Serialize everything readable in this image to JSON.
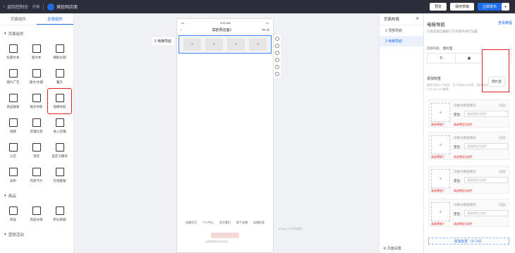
{
  "topbar": {
    "back_label": "返回控制台",
    "store_label": "店铺",
    "brand_label": "Bai",
    "page_name": "莫欧网店面",
    "preview": "预览",
    "save_draft": "保存草稿",
    "publish": "立即发布",
    "more_icon": "caret-down-icon"
  },
  "left": {
    "tabs": [
      "页面组件",
      "全局组件"
    ],
    "sections": [
      {
        "title": "页面组件",
        "items": [
          "标题文本",
          "富文本",
          "辅助分割",
          "图片广告",
          "图文/文图",
          "魔方",
          "商品搜索",
          "图文导航",
          "电梯导航",
          "视频",
          "店铺信息",
          "进入店铺",
          "公告",
          "语音",
          "自定义模块",
          "返积",
          "内容卡片",
          "在线客服"
        ]
      },
      {
        "title": "商品",
        "items": [
          "商品",
          "商品分组",
          "积分商城"
        ]
      },
      {
        "title": "营销活动",
        "items": []
      }
    ],
    "selected_item": "电梯导航"
  },
  "canvas": {
    "label": "2 电梯导航",
    "status_time": "9:41 AM",
    "page_title": "莫欧网店面1",
    "footer_links": [
      "店铺主页",
      "个人中心",
      "关注我们",
      "联下店铺",
      "店铺信息"
    ],
    "footer_note": "由有赞提供技术支持",
    "hint": "iPhone 13手机预览"
  },
  "layers": {
    "title": "页面布局",
    "items": [
      "1 顶部导航",
      "2 电梯导航"
    ],
    "active": "2 电梯导航",
    "footer": "页面设置"
  },
  "props": {
    "title": "电梯导航",
    "help": "查看教程",
    "desc": "只能选择已编辑下方的组件进行设置",
    "style_label": "选择导航",
    "style_value": "图片型",
    "style_options": [
      "Tr",
      "图",
      "图"
    ],
    "popup_label": "图片型",
    "add_label": "添加标签",
    "add_desc": "最多添加20个标签，至少添加4个标签，图片建议尺寸100*100像素",
    "cards": [
      {
        "name": "切换为橱窗模块",
        "loc_label": "定位:",
        "loc_placeholder": "请选择定位组件",
        "err1": "请选择图片",
        "err2": "请选择定位组件"
      },
      {
        "name": "切换为橱窗模块",
        "loc_label": "定位:",
        "loc_placeholder": "请选择定位组件",
        "err1": "请选择图片",
        "err2": "请选择定位组件"
      },
      {
        "name": "切换为橱窗模块",
        "loc_label": "定位:",
        "loc_placeholder": "请选择定位组件",
        "err1": "请选择图片",
        "err2": "请选择定位组件"
      },
      {
        "name": "切换为橱窗模块",
        "loc_label": "定位:",
        "loc_placeholder": "请选择定位组件",
        "err1": "请选择图片",
        "err2": "请选择定位组件"
      }
    ],
    "add_button": "添加标签（4 / 20）"
  }
}
